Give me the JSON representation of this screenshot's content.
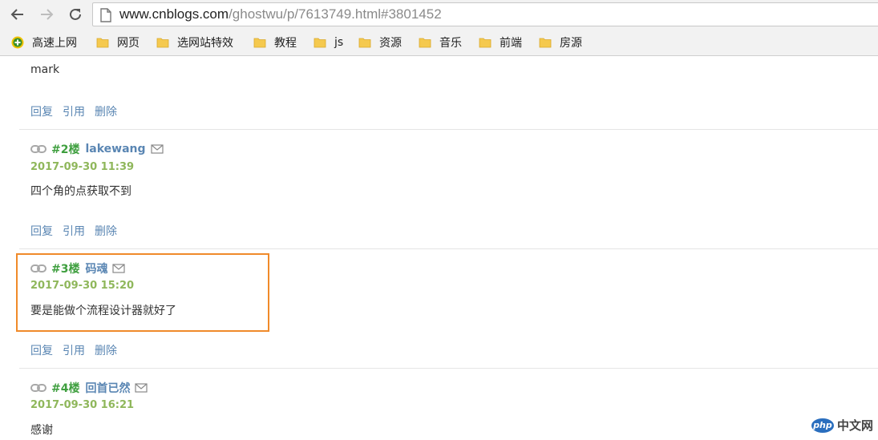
{
  "browser": {
    "url_host": "www.cnblogs.com",
    "url_path": "/ghostwu/p/7613749.html#3801452"
  },
  "bookmarks": [
    {
      "label": "高速上网",
      "icon": "plus-circle-icon"
    },
    {
      "label": "网页",
      "icon": "folder-icon"
    },
    {
      "label": "选网站特效",
      "icon": "folder-icon"
    },
    {
      "label": "教程",
      "icon": "folder-icon"
    },
    {
      "label": "js",
      "icon": "folder-icon"
    },
    {
      "label": "资源",
      "icon": "folder-icon"
    },
    {
      "label": "音乐",
      "icon": "folder-icon"
    },
    {
      "label": "前端",
      "icon": "folder-icon"
    },
    {
      "label": "房源",
      "icon": "folder-icon"
    }
  ],
  "actions": {
    "reply": "回复",
    "quote": "引用",
    "delete": "删除"
  },
  "comments": [
    {
      "floor": "",
      "author": "",
      "date": "",
      "text": "mark"
    },
    {
      "floor": "#2楼",
      "author": "lakewang",
      "date": "2017-09-30 11:39",
      "text": "四个角的点获取不到"
    },
    {
      "floor": "#3楼",
      "author": "码魂",
      "date": "2017-09-30 15:20",
      "text": "要是能做个流程设计器就好了"
    },
    {
      "floor": "#4楼",
      "author": "回首已然",
      "date": "2017-09-30 16:21",
      "text": "感谢"
    }
  ],
  "watermark": {
    "php": "php",
    "text": "中文网"
  },
  "colors": {
    "link": "#5a86b3",
    "floor": "#3f9f3f",
    "date": "#8fb75b",
    "highlight": "#f08a2a"
  }
}
